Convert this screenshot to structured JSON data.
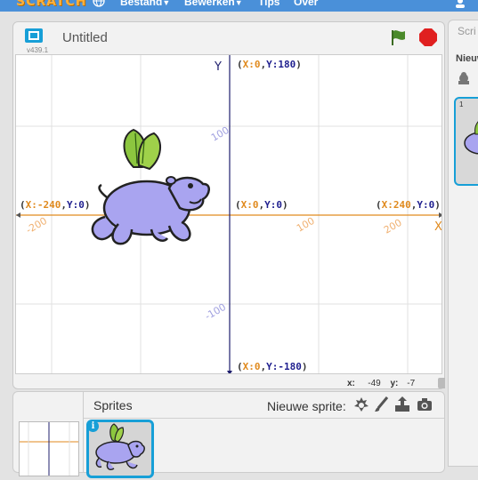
{
  "menu": {
    "logo": "SCRATCH",
    "items": [
      {
        "label": "Bestand",
        "has_caret": true
      },
      {
        "label": "Bewerken",
        "has_caret": true
      },
      {
        "label": "Tips",
        "has_caret": false
      },
      {
        "label": "Over",
        "has_caret": false
      }
    ]
  },
  "stage_header": {
    "title": "Untitled",
    "version": "v439.1"
  },
  "stage": {
    "axis_x_name": "X",
    "axis_y_name": "Y",
    "labels": {
      "top": {
        "x": "X:0",
        "y": "Y:180"
      },
      "left": {
        "x": "X:-240",
        "y": "Y:0"
      },
      "center": {
        "x": "X:0",
        "y": "Y:0"
      },
      "right": {
        "x": "X:240",
        "y": "Y:0"
      },
      "bottom": {
        "x": "X:0",
        "y": "Y:-180"
      }
    },
    "tick_labels": {
      "y_pos": "100",
      "y_neg": "-100",
      "x_neg": "-200",
      "x_pos1": "100",
      "x_pos2": "200"
    },
    "colors": {
      "x_axis": "#e08a1e",
      "y_axis": "#1f1f6e",
      "x_label": "#e08a1e",
      "y_label": "#1f1f8f",
      "x_tick": "#f0b070",
      "y_tick": "#a0a0e0",
      "grid": "#e0e0e0"
    }
  },
  "mouse_coords": {
    "x_label": "x:",
    "x_value": "-49",
    "y_label": "y:",
    "y_value": "-7"
  },
  "sprites_panel": {
    "title": "Sprites",
    "new_sprite_label": "Nieuwe sprite:",
    "tools": [
      "sprite-library-icon",
      "paint-brush-icon",
      "upload-icon",
      "camera-icon"
    ]
  },
  "right_panel": {
    "tab_label": "Scri",
    "new_label": "Nieuw",
    "costume_number": "1"
  },
  "accent_color": "#179fd7"
}
